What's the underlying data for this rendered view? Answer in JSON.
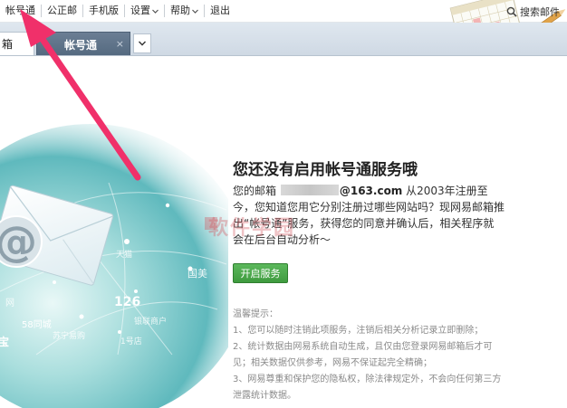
{
  "menu": {
    "items": [
      {
        "label": "帐号通",
        "dropdown": false
      },
      {
        "label": "公正邮",
        "dropdown": false
      },
      {
        "label": "手机版",
        "dropdown": false
      },
      {
        "label": "设置",
        "dropdown": true
      },
      {
        "label": "帮助",
        "dropdown": true
      },
      {
        "label": "退出",
        "dropdown": false
      }
    ],
    "search_label": "搜索邮件"
  },
  "tabs": {
    "first_label": "箱",
    "active_label": "帐号通",
    "close_glyph": "×"
  },
  "illustration": {
    "labels": {
      "at": "@",
      "n126": "126",
      "tianya": "天猫",
      "guomei": "国美",
      "sanbaishou": "58同城",
      "suning": "苏宁易购",
      "yihao": "1号店",
      "yinhang": "银联商户",
      "wang": "网",
      "bao": "宝"
    }
  },
  "content": {
    "title": "您还没有启用帐号通服务哦",
    "intro_prefix": "您的邮箱",
    "email_domain": "@163.com",
    "intro_suffix": "从2003年注册至今，您知道您用它分别注册过哪些网站吗？现网易邮箱推出“帐号通”服务，获得您的同意并确认后，相关程序就会在后台自动分析～",
    "open_button": "开启服务",
    "tips_title": "温馨提示：",
    "tips": [
      "1、您可以随时注销此项服务，注销后相关分析记录立即删除；",
      "2、统计数据由网易系统自动生成，且仅由您登录网易邮箱后才可",
      "见；相关数据仅供参考，网易不保证起完全精确；",
      "3、网易尊重和保护您的隐私权，除法律规定外，不会向任何第三方",
      "泄露统计数据。"
    ]
  },
  "watermark": "软件学园",
  "colors": {
    "accent_green": "#4cae4c",
    "tab_active": "#5d7189",
    "arrow": "#f0306a",
    "teal": "#8fd3d6"
  }
}
